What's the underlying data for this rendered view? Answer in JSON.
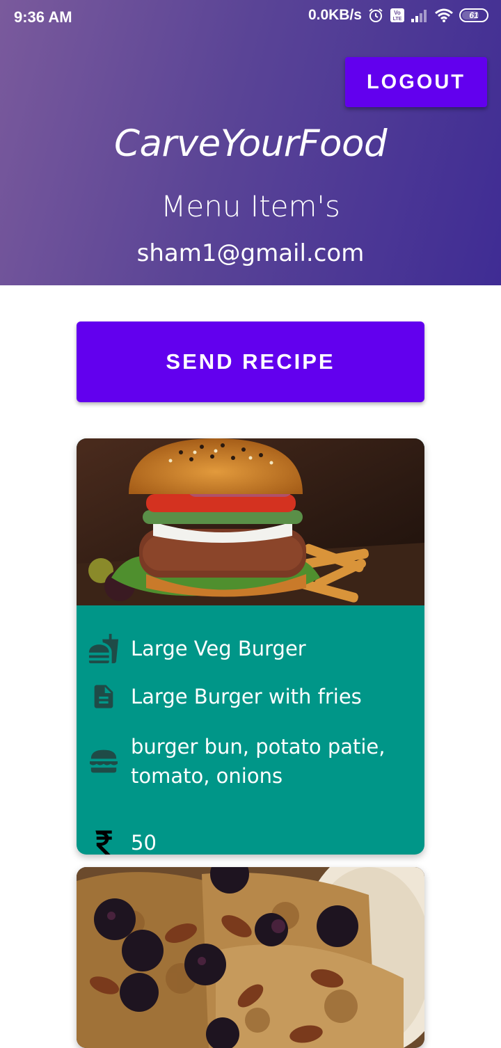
{
  "status_bar": {
    "time": "9:36 AM",
    "network_speed": "0.0KB/s",
    "volte_label": "Vo LTE",
    "battery": "61"
  },
  "header": {
    "logout_label": "LOGOUT",
    "app_title": "CarveYourFood",
    "page_title": "Menu Item's",
    "user_email": "sham1@gmail.com",
    "gradient_start": "#7a5a9c",
    "gradient_end": "#3f2c94"
  },
  "actions": {
    "send_recipe_label": "SEND RECIPE",
    "accent_color": "#6200ee"
  },
  "menu_items": [
    {
      "image": "burger-photo",
      "name": "Large Veg Burger",
      "description": "Large Burger with fries",
      "ingredients": "burger bun, potato patie, tomato, onions",
      "price": "50",
      "card_color": "#009688",
      "icons": [
        "fastfood-icon",
        "document-icon",
        "hamburger-icon",
        "rupee-icon"
      ]
    },
    {
      "image": "french-toast-photo"
    }
  ]
}
